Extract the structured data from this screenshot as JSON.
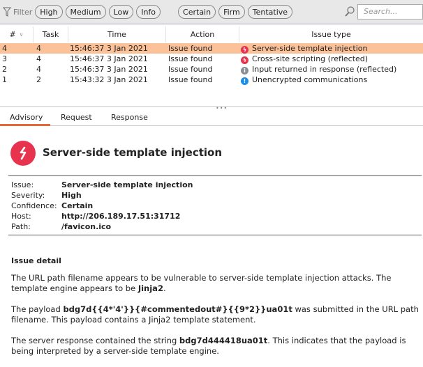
{
  "filter": {
    "label": "Filter",
    "severity": [
      "High",
      "Medium",
      "Low",
      "Info"
    ],
    "confidence": [
      "Certain",
      "Firm",
      "Tentative"
    ],
    "search_placeholder": "Search..."
  },
  "table": {
    "headers": [
      "#",
      "Task",
      "Time",
      "Action",
      "Issue type"
    ],
    "rows": [
      {
        "num": "4",
        "task": "4",
        "time": "15:46:37 3 Jan 2021",
        "action": "Issue found",
        "issue": "Server-side template injection",
        "severity": "high",
        "selected": true
      },
      {
        "num": "3",
        "task": "4",
        "time": "15:46:37 3 Jan 2021",
        "action": "Issue found",
        "issue": "Cross-site scripting (reflected)",
        "severity": "high"
      },
      {
        "num": "2",
        "task": "4",
        "time": "15:46:37 3 Jan 2021",
        "action": "Issue found",
        "issue": "Input returned in response (reflected)",
        "severity": "info"
      },
      {
        "num": "1",
        "task": "2",
        "time": "15:43:32 3 Jan 2021",
        "action": "Issue found",
        "issue": "Unencrypted communications",
        "severity": "low"
      }
    ]
  },
  "tabs": [
    "Advisory",
    "Request",
    "Response"
  ],
  "advisory": {
    "title": "Server-side template injection",
    "fields": [
      {
        "k": "Issue:",
        "v": "Server-side template injection"
      },
      {
        "k": "Severity:",
        "v": "High"
      },
      {
        "k": "Confidence:",
        "v": "Certain"
      },
      {
        "k": "Host:",
        "v": "http://206.189.17.51:31712"
      },
      {
        "k": "Path:",
        "v": "/favicon.ico"
      }
    ],
    "detail_heading": "Issue detail",
    "p1a": "The URL path filename appears to be vulnerable to server-side template injection attacks. The template engine appears to be ",
    "p1b": "Jinja2",
    "p1c": ".",
    "p2a": "The payload ",
    "p2b": "bdg7d{{4*'4'}}{#commentedout#}{{9*2}}ua01t",
    "p2c": " was submitted in the URL path filename. This payload contains a Jinja2 template statement.",
    "p3a": "The server response contained the string ",
    "p3b": "bdg7d444418ua01t",
    "p3c": ". This indicates that the payload is being interpreted by a server-side template engine."
  },
  "colors": {
    "high": "#e8334e",
    "info": "#8a8f96",
    "low": "#1a8de6",
    "selected": "#fbc29a",
    "accent": "#e8663a"
  }
}
